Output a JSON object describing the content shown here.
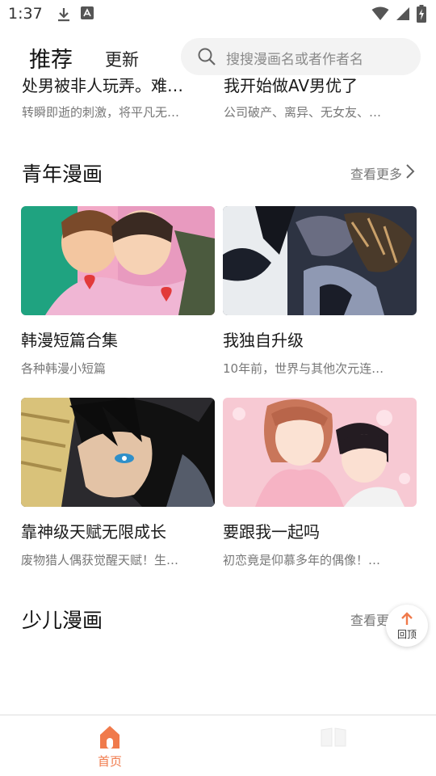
{
  "status_bar": {
    "time": "1:37",
    "icons_left": [
      "download-icon",
      "app-icon"
    ],
    "icons_right": [
      "wifi-icon",
      "signal-icon",
      "battery-icon"
    ]
  },
  "header": {
    "tab_recommend": "推荐",
    "tab_update": "更新",
    "search_placeholder": "搜搜漫画名或者作者名"
  },
  "partial_items": [
    {
      "title": "处男被非人玩弄。难…",
      "desc": "转瞬即逝的刺激，将平凡无…"
    },
    {
      "title": "我开始做AV男优了",
      "desc": "公司破产、离异、无女友、…"
    }
  ],
  "sections": [
    {
      "title": "青年漫画",
      "more_label": "查看更多",
      "items": [
        {
          "title": "韩漫短篇合集",
          "desc": "各种韩漫小短篇"
        },
        {
          "title": "我独自升级",
          "desc": "10年前，世界与其他次元连…"
        },
        {
          "title": "靠神级天赋无限成长",
          "desc": "废物猎人偶获觉醒天赋！生…"
        },
        {
          "title": "要跟我一起吗",
          "desc": "初恋竟是仰慕多年的偶像！…"
        }
      ]
    },
    {
      "title": "少儿漫画",
      "more_label": "查看更多",
      "items": []
    }
  ],
  "back_to_top": {
    "label": "回顶"
  },
  "bottom_nav": {
    "home_label": "首页",
    "active_color": "#f07a4b"
  }
}
